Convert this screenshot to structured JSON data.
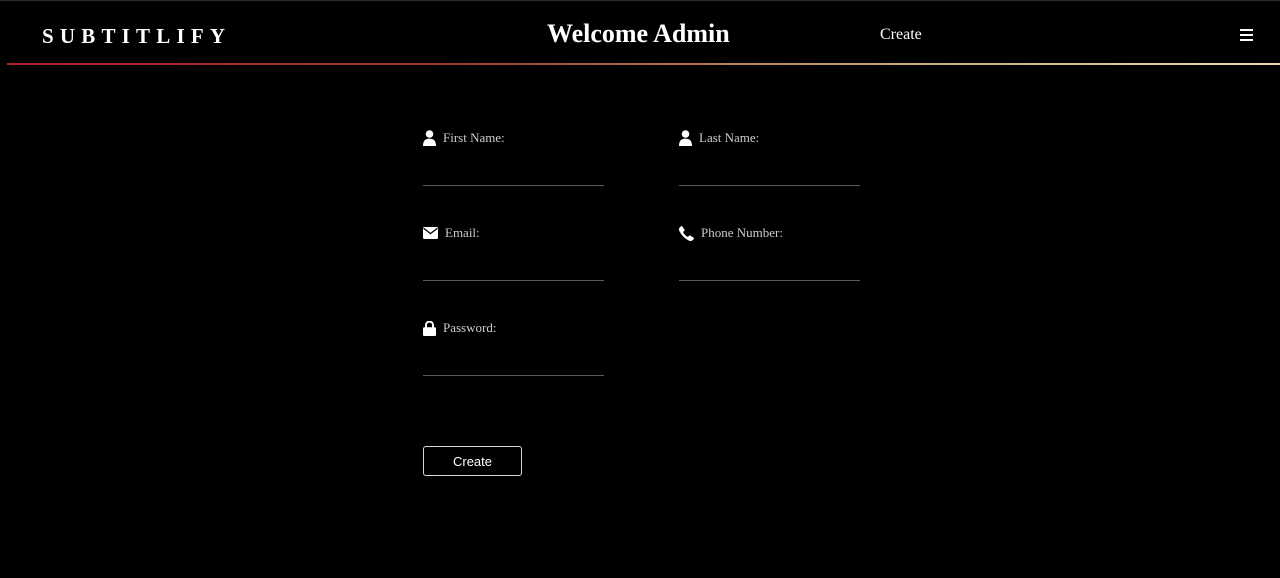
{
  "header": {
    "brand": "SUBTITLIFY",
    "welcome": "Welcome Admin",
    "nav_create": "Create",
    "menu_icon": "hamburger-menu-icon"
  },
  "form": {
    "first_name": {
      "label": "First Name:",
      "icon": "user-icon",
      "value": ""
    },
    "last_name": {
      "label": "Last Name:",
      "icon": "user-icon",
      "value": ""
    },
    "email": {
      "label": "Email:",
      "icon": "envelope-icon",
      "value": ""
    },
    "phone": {
      "label": "Phone Number:",
      "icon": "phone-icon",
      "value": ""
    },
    "password": {
      "label": "Password:",
      "icon": "lock-icon",
      "value": ""
    },
    "submit_label": "Create"
  },
  "colors": {
    "background": "#000000",
    "text": "#ffffff",
    "accent_gradient_start": "#b0202a",
    "accent_gradient_end": "#e8dcb0"
  }
}
